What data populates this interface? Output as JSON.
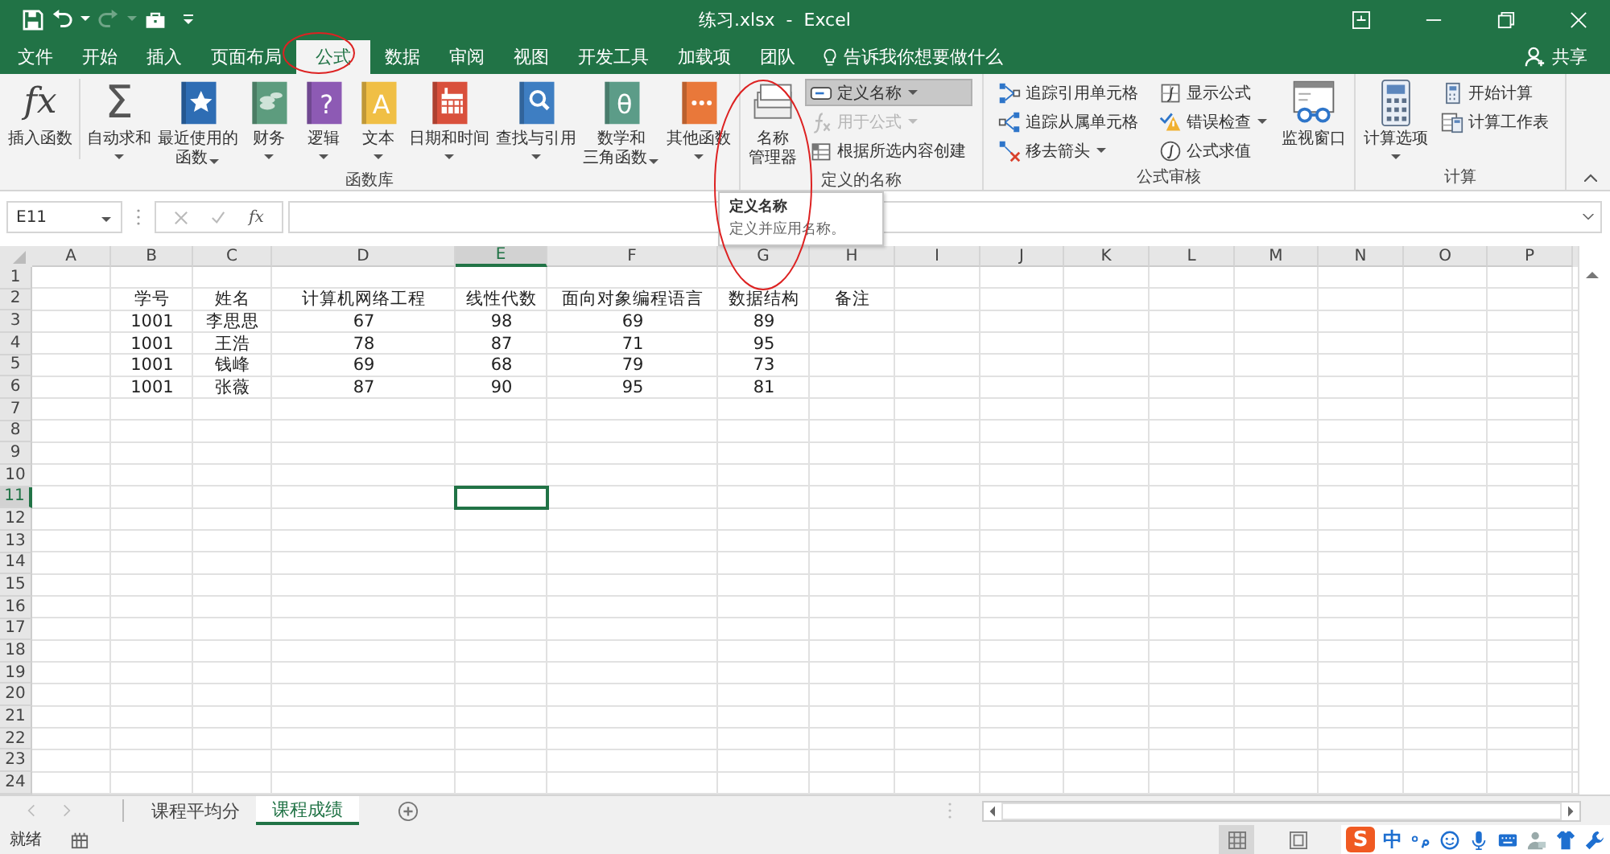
{
  "window": {
    "title": "练习.xlsx  -  Excel"
  },
  "tabs": [
    {
      "label": "文件",
      "selected": false
    },
    {
      "label": "开始",
      "selected": false
    },
    {
      "label": "插入",
      "selected": false
    },
    {
      "label": "页面布局",
      "selected": false
    },
    {
      "label": "公式",
      "selected": true
    },
    {
      "label": "数据",
      "selected": false
    },
    {
      "label": "审阅",
      "selected": false
    },
    {
      "label": "视图",
      "selected": false
    },
    {
      "label": "开发工具",
      "selected": false
    },
    {
      "label": "加载项",
      "selected": false
    },
    {
      "label": "团队",
      "selected": false
    }
  ],
  "tell_me": {
    "placeholder": "告诉我你想要做什么"
  },
  "share": "共享",
  "ribbon_groups": [
    {
      "label": "函数库",
      "columns": [
        {
          "kind": "large",
          "label": [
            "插入函数"
          ],
          "dropdown": false,
          "glyph": "fx",
          "separated": true
        },
        {
          "kind": "large",
          "label": [
            "自动求和"
          ],
          "dropdown": true,
          "glyph": "Σ",
          "separated": false
        },
        {
          "kind": "large",
          "label": [
            "最近使用的",
            "函数"
          ],
          "dropdown": true,
          "separated": false
        },
        {
          "kind": "large",
          "label": [
            "财务"
          ],
          "dropdown": true,
          "separated": false
        },
        {
          "kind": "large",
          "label": [
            "逻辑"
          ],
          "dropdown": true,
          "glyph": "?",
          "separated": false
        },
        {
          "kind": "large",
          "label": [
            "文本"
          ],
          "dropdown": true,
          "glyph": "A",
          "separated": false
        },
        {
          "kind": "large",
          "label": [
            "日期和时间"
          ],
          "dropdown": true,
          "separated": false
        },
        {
          "kind": "large",
          "label": [
            "查找与引用"
          ],
          "dropdown": true,
          "separated": false
        },
        {
          "kind": "large",
          "label": [
            "数学和",
            "三角函数"
          ],
          "dropdown": true,
          "glyph": "θ",
          "separated": false
        },
        {
          "kind": "large",
          "label": [
            "其他函数"
          ],
          "dropdown": true,
          "separated": false
        }
      ]
    },
    {
      "label": "定义的名称",
      "columns": [
        {
          "kind": "large",
          "label": [
            "名称",
            "管理器"
          ],
          "dropdown": false,
          "separated": false
        },
        {
          "kind": "stack",
          "buttons": [
            {
              "label": "定义名称",
              "highlighted": true,
              "disabled": false,
              "dropdown": true
            },
            {
              "label": "用于公式",
              "highlighted": false,
              "disabled": true,
              "dropdown": true
            },
            {
              "label": "根据所选内容创建",
              "highlighted": false,
              "disabled": false,
              "dropdown": false
            }
          ]
        }
      ]
    },
    {
      "label": "公式审核",
      "columns": [
        {
          "kind": "stack",
          "buttons": [
            {
              "label": "追踪引用单元格",
              "highlighted": false,
              "disabled": false,
              "dropdown": false
            },
            {
              "label": "追踪从属单元格",
              "highlighted": false,
              "disabled": false,
              "dropdown": false
            },
            {
              "label": "移去箭头",
              "highlighted": false,
              "disabled": false,
              "dropdown": true
            }
          ]
        },
        {
          "kind": "stack",
          "buttons": [
            {
              "label": "显示公式",
              "highlighted": false,
              "disabled": false,
              "dropdown": false
            },
            {
              "label": "错误检查",
              "highlighted": false,
              "disabled": false,
              "dropdown": true
            },
            {
              "label": "公式求值",
              "highlighted": false,
              "disabled": false,
              "dropdown": false
            }
          ]
        },
        {
          "kind": "large",
          "label": [
            "监视窗口"
          ],
          "dropdown": false,
          "separated": false
        }
      ]
    },
    {
      "label": "计算",
      "columns": [
        {
          "kind": "large",
          "label": [
            "计算选项"
          ],
          "dropdown": true,
          "separated": false
        },
        {
          "kind": "stack",
          "buttons": [
            {
              "label": "开始计算",
              "highlighted": false,
              "disabled": false,
              "dropdown": false
            },
            {
              "label": "计算工作表",
              "highlighted": false,
              "disabled": false,
              "dropdown": false
            }
          ]
        }
      ]
    }
  ],
  "tooltip": {
    "title": "定义名称",
    "text": "定义并应用名称。"
  },
  "name_box": "E11",
  "formula_glyph": "fx",
  "columns": [
    {
      "label": "A",
      "selected": false
    },
    {
      "label": "B",
      "selected": false
    },
    {
      "label": "C",
      "selected": false
    },
    {
      "label": "D",
      "selected": false
    },
    {
      "label": "E",
      "selected": true
    },
    {
      "label": "F",
      "selected": false
    },
    {
      "label": "G",
      "selected": false
    },
    {
      "label": "H",
      "selected": false
    },
    {
      "label": "I",
      "selected": false
    },
    {
      "label": "J",
      "selected": false
    },
    {
      "label": "K",
      "selected": false
    },
    {
      "label": "L",
      "selected": false
    },
    {
      "label": "M",
      "selected": false
    },
    {
      "label": "N",
      "selected": false
    },
    {
      "label": "O",
      "selected": false
    },
    {
      "label": "P",
      "selected": false
    }
  ],
  "rows": [
    {
      "label": "1",
      "selected": false
    },
    {
      "label": "2",
      "selected": false,
      "cells": [
        null,
        "学号",
        "姓名",
        "计算机网络工程",
        "线性代数",
        "面向对象编程语言",
        "数据结构",
        "备注"
      ]
    },
    {
      "label": "3",
      "selected": false,
      "cells": [
        null,
        "1001",
        "李思思",
        "67",
        "98",
        "69",
        "89"
      ]
    },
    {
      "label": "4",
      "selected": false,
      "cells": [
        null,
        "1001",
        "王浩",
        "78",
        "87",
        "71",
        "95"
      ]
    },
    {
      "label": "5",
      "selected": false,
      "cells": [
        null,
        "1001",
        "钱峰",
        "69",
        "68",
        "79",
        "73"
      ]
    },
    {
      "label": "6",
      "selected": false,
      "cells": [
        null,
        "1001",
        "张薇",
        "87",
        "90",
        "95",
        "81"
      ]
    },
    {
      "label": "7",
      "selected": false
    },
    {
      "label": "8",
      "selected": false
    },
    {
      "label": "9",
      "selected": false
    },
    {
      "label": "10",
      "selected": false
    },
    {
      "label": "11",
      "selected": true
    },
    {
      "label": "12",
      "selected": false
    },
    {
      "label": "13",
      "selected": false
    },
    {
      "label": "14",
      "selected": false
    },
    {
      "label": "15",
      "selected": false
    },
    {
      "label": "16",
      "selected": false
    },
    {
      "label": "17",
      "selected": false
    },
    {
      "label": "18",
      "selected": false
    },
    {
      "label": "19",
      "selected": false
    },
    {
      "label": "20",
      "selected": false
    },
    {
      "label": "21",
      "selected": false
    },
    {
      "label": "22",
      "selected": false
    },
    {
      "label": "23",
      "selected": false
    },
    {
      "label": "24",
      "selected": false
    }
  ],
  "sheets": [
    {
      "label": "课程平均分",
      "selected": false
    },
    {
      "label": "课程成绩",
      "selected": true
    }
  ],
  "status": "就绪",
  "ime": {
    "logo": "S",
    "mode": "中"
  }
}
